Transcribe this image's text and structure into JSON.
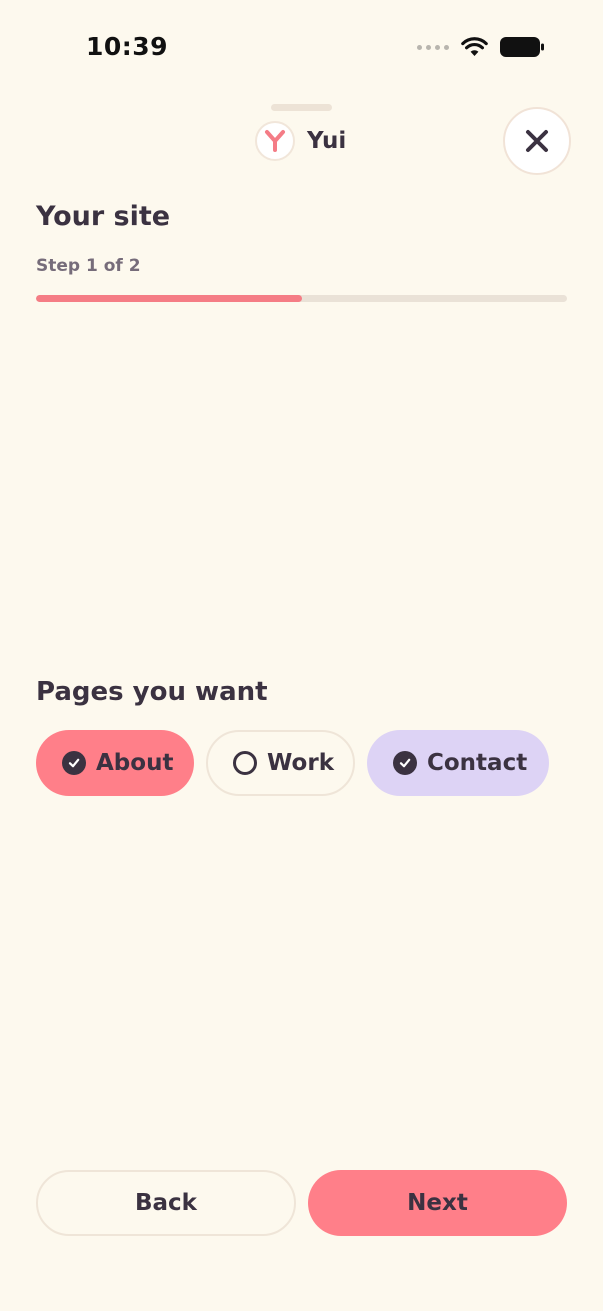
{
  "status_bar": {
    "time": "10:39"
  },
  "header": {
    "brand_name": "Yui"
  },
  "title": "Your site",
  "step": {
    "label": "Step 1 of 2",
    "progress": 0.5
  },
  "section_title": "Pages you want",
  "chips": [
    {
      "label": "About",
      "selected": true,
      "color": "#FF7F89"
    },
    {
      "label": "Work",
      "selected": false,
      "color": "#FDF9EE"
    },
    {
      "label": "Contact",
      "selected": true,
      "color": "#DDD3F5"
    }
  ],
  "footer": {
    "back_label": "Back",
    "next_label": "Next"
  },
  "colors": {
    "background": "#FDF9EE",
    "accent": "#FF7F89",
    "text": "#3B3241",
    "lavender": "#DDD3F5"
  },
  "icons": [
    "wifi-icon",
    "battery-icon",
    "brand-logo-icon",
    "close-icon",
    "check-icon"
  ]
}
